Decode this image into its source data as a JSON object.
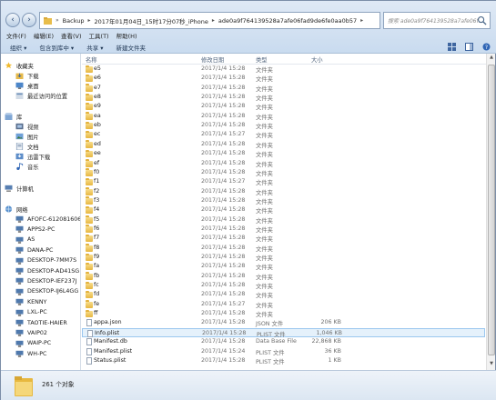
{
  "address": {
    "crumbs": [
      "Backup",
      "2017年01月04日_15时17分07秒_iPhone",
      "ade0a9f764139528a7afe06fad9de6fe0aa0b57"
    ],
    "search_placeholder": "搜索 ade0a9f764139528a7afe06f..."
  },
  "menu": [
    "文件(F)",
    "编辑(E)",
    "查看(V)",
    "工具(T)",
    "帮助(H)"
  ],
  "toolbar": {
    "organize": "组织 ▾",
    "include": "包含到库中 ▾",
    "share": "共享 ▾",
    "new_folder": "新建文件夹"
  },
  "navpane": {
    "favorites": "收藏夹",
    "fav_items": [
      "下载",
      "桌面",
      "最近访问的位置"
    ],
    "libraries": "库",
    "lib_items": [
      "视频",
      "图片",
      "文档",
      "迅雷下载",
      "音乐"
    ],
    "computer": "计算机",
    "network": "网络",
    "net_items": [
      "AFOFC-612081606",
      "APPS2-PC",
      "AS",
      "DANA-PC",
      "DESKTOP-7MM7S",
      "DESKTOP-AD41SG",
      "DESKTOP-IEF237J",
      "DESKTOP-IJ6L4GG",
      "KENNY",
      "LXL-PC",
      "TAOTIE-HAIER",
      "VAIP02",
      "WAIP-PC",
      "WH-PC"
    ]
  },
  "columns": {
    "name": "名称",
    "date": "修改日期",
    "type": "类型",
    "size": "大小"
  },
  "files": [
    {
      "name": "e5",
      "date": "2017/1/4 15:28",
      "type": "文件夹",
      "size": ""
    },
    {
      "name": "e6",
      "date": "2017/1/4 15:28",
      "type": "文件夹",
      "size": ""
    },
    {
      "name": "e7",
      "date": "2017/1/4 15:28",
      "type": "文件夹",
      "size": ""
    },
    {
      "name": "e8",
      "date": "2017/1/4 15:28",
      "type": "文件夹",
      "size": ""
    },
    {
      "name": "e9",
      "date": "2017/1/4 15:28",
      "type": "文件夹",
      "size": ""
    },
    {
      "name": "ea",
      "date": "2017/1/4 15:28",
      "type": "文件夹",
      "size": ""
    },
    {
      "name": "eb",
      "date": "2017/1/4 15:28",
      "type": "文件夹",
      "size": ""
    },
    {
      "name": "ec",
      "date": "2017/1/4 15:27",
      "type": "文件夹",
      "size": ""
    },
    {
      "name": "ed",
      "date": "2017/1/4 15:28",
      "type": "文件夹",
      "size": ""
    },
    {
      "name": "ee",
      "date": "2017/1/4 15:28",
      "type": "文件夹",
      "size": ""
    },
    {
      "name": "ef",
      "date": "2017/1/4 15:28",
      "type": "文件夹",
      "size": ""
    },
    {
      "name": "f0",
      "date": "2017/1/4 15:28",
      "type": "文件夹",
      "size": ""
    },
    {
      "name": "f1",
      "date": "2017/1/4 15:27",
      "type": "文件夹",
      "size": ""
    },
    {
      "name": "f2",
      "date": "2017/1/4 15:28",
      "type": "文件夹",
      "size": ""
    },
    {
      "name": "f3",
      "date": "2017/1/4 15:28",
      "type": "文件夹",
      "size": ""
    },
    {
      "name": "f4",
      "date": "2017/1/4 15:28",
      "type": "文件夹",
      "size": ""
    },
    {
      "name": "f5",
      "date": "2017/1/4 15:28",
      "type": "文件夹",
      "size": ""
    },
    {
      "name": "f6",
      "date": "2017/1/4 15:28",
      "type": "文件夹",
      "size": ""
    },
    {
      "name": "f7",
      "date": "2017/1/4 15:28",
      "type": "文件夹",
      "size": ""
    },
    {
      "name": "f8",
      "date": "2017/1/4 15:28",
      "type": "文件夹",
      "size": ""
    },
    {
      "name": "f9",
      "date": "2017/1/4 15:28",
      "type": "文件夹",
      "size": ""
    },
    {
      "name": "fa",
      "date": "2017/1/4 15:28",
      "type": "文件夹",
      "size": ""
    },
    {
      "name": "fb",
      "date": "2017/1/4 15:28",
      "type": "文件夹",
      "size": ""
    },
    {
      "name": "fc",
      "date": "2017/1/4 15:28",
      "type": "文件夹",
      "size": ""
    },
    {
      "name": "fd",
      "date": "2017/1/4 15:28",
      "type": "文件夹",
      "size": ""
    },
    {
      "name": "fe",
      "date": "2017/1/4 15:27",
      "type": "文件夹",
      "size": ""
    },
    {
      "name": "ff",
      "date": "2017/1/4 15:28",
      "type": "文件夹",
      "size": ""
    },
    {
      "name": "appa.json",
      "date": "2017/1/4 15:28",
      "type": "JSON 文件",
      "size": "206 KB"
    },
    {
      "name": "Info.plist",
      "date": "2017/1/4 15:28",
      "type": "PLIST 文件",
      "size": "1,046 KB"
    },
    {
      "name": "Manifest.db",
      "date": "2017/1/4 15:28",
      "type": "Data Base File",
      "size": "22,868 KB"
    },
    {
      "name": "Manifest.plist",
      "date": "2017/1/4 15:24",
      "type": "PLIST 文件",
      "size": "36 KB"
    },
    {
      "name": "Status.plist",
      "date": "2017/1/4 15:28",
      "type": "PLIST 文件",
      "size": "1 KB"
    }
  ],
  "selected_index": 28,
  "status": {
    "count_text": "261 个对象"
  }
}
